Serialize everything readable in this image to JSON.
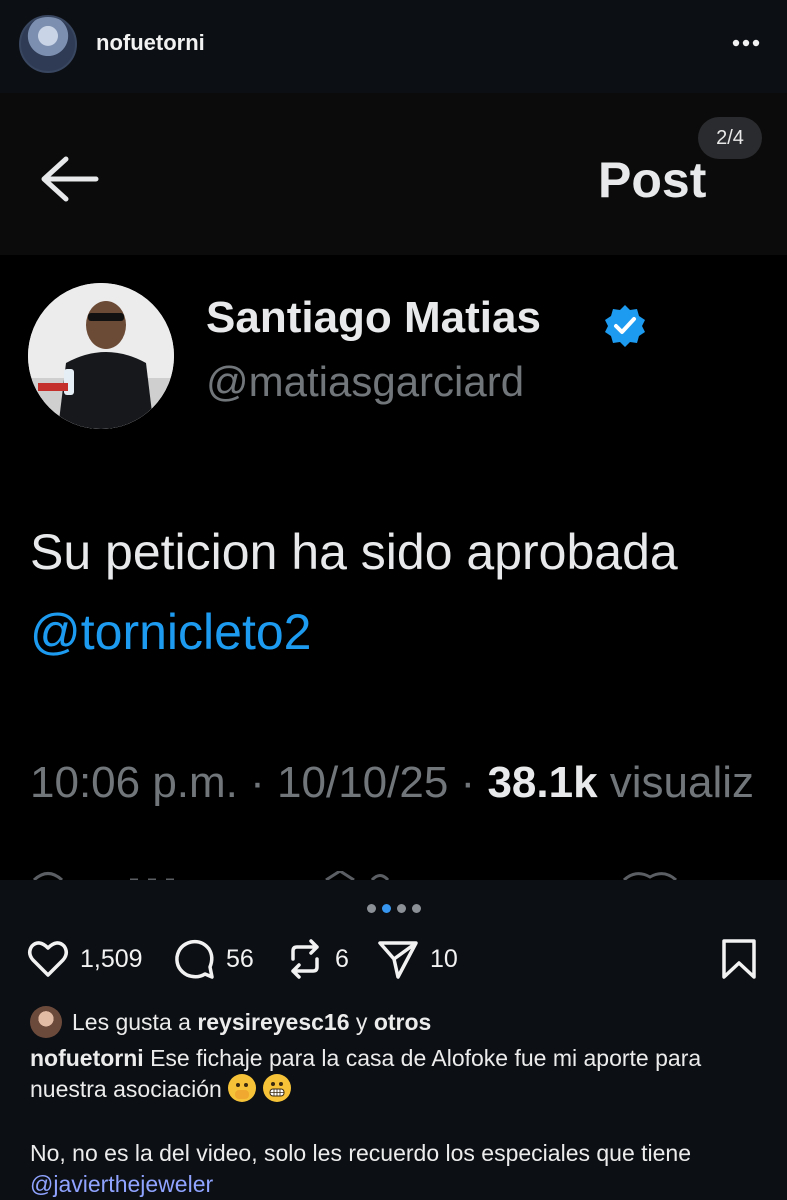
{
  "header": {
    "username": "nofuetorni",
    "more_icon": "more-horizontal-icon"
  },
  "post_image": {
    "slide_counter": "2/4",
    "tweet": {
      "top_title": "Post",
      "author_name": "Santiago Matias",
      "author_handle": "@matiasgarciard",
      "text": "Su peticion ha sido aprobada",
      "mention": "@tornicleto2",
      "time": "10:06 p.m.",
      "date": "10/10/25",
      "separator": "·",
      "views_count": "38.1k",
      "views_label": "visualiz"
    }
  },
  "carousel": {
    "count": 4,
    "active_index": 1
  },
  "actions": {
    "likes": "1,509",
    "comments": "56",
    "reposts": "6",
    "shares": "10"
  },
  "likes_line": {
    "prefix": "Les gusta a",
    "user": "reysireyesc16",
    "joiner": "y",
    "others": "otros"
  },
  "caption": {
    "username": "nofuetorni",
    "text": "Ese fichaje para la casa de Alofoke fue mi aporte para nuestra asociación",
    "second_paragraph": "No, no es la del video, solo les recuerdo los especiales que tiene",
    "mention": "@javierthejeweler"
  },
  "colors": {
    "background": "#0c0f14",
    "twitter_blue": "#1d9bf0",
    "active_dot": "#3797f0",
    "ig_mention": "#8fa3ff"
  }
}
